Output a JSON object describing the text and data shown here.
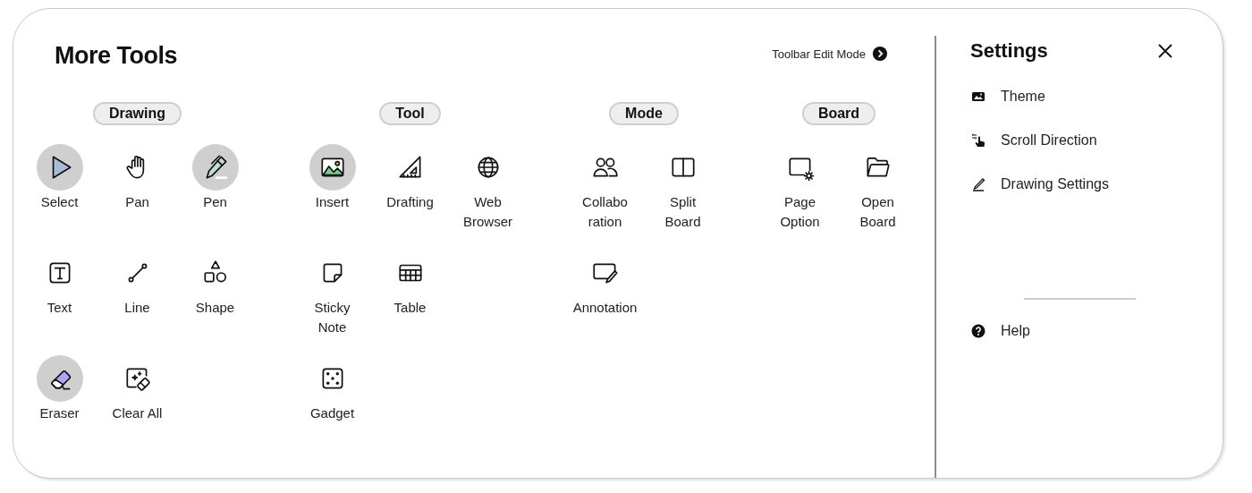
{
  "title": "More Tools",
  "toolbar_edit_mode": {
    "label": "Toolbar Edit Mode"
  },
  "groups": [
    {
      "header": "Drawing",
      "rows": [
        [
          {
            "label": "Select",
            "selected": true
          },
          {
            "label": "Pan",
            "selected": false
          },
          {
            "label": "Pen",
            "selected": true
          }
        ],
        [
          {
            "label": "Text",
            "selected": false
          },
          {
            "label": "Line",
            "selected": false
          },
          {
            "label": "Shape",
            "selected": false
          }
        ],
        [
          {
            "label": "Eraser",
            "selected": true
          },
          {
            "label": "Clear All",
            "selected": false
          }
        ]
      ]
    },
    {
      "header": "Tool",
      "rows": [
        [
          {
            "label": "Insert",
            "selected": true
          },
          {
            "label": "Drafting",
            "selected": false
          },
          {
            "label": "Web\nBrowser",
            "selected": false
          }
        ],
        [
          {
            "label": "Sticky\nNote",
            "selected": false
          },
          {
            "label": "Table",
            "selected": false
          }
        ],
        [
          {
            "label": "Gadget",
            "selected": false
          }
        ]
      ]
    },
    {
      "header": "Mode",
      "rows": [
        [
          {
            "label": "Collabo\nration",
            "selected": false
          },
          {
            "label": "Split\nBoard",
            "selected": false
          }
        ],
        [
          {
            "label": "Annotation",
            "selected": false
          }
        ]
      ]
    },
    {
      "header": "Board",
      "rows": [
        [
          {
            "label": "Page\nOption",
            "selected": false
          },
          {
            "label": "Open\nBoard",
            "selected": false
          }
        ]
      ]
    }
  ],
  "settings": {
    "title": "Settings",
    "items": [
      {
        "label": "Theme"
      },
      {
        "label": "Scroll Direction"
      },
      {
        "label": "Drawing Settings"
      }
    ],
    "footer_items": [
      {
        "label": "Help"
      }
    ]
  }
}
